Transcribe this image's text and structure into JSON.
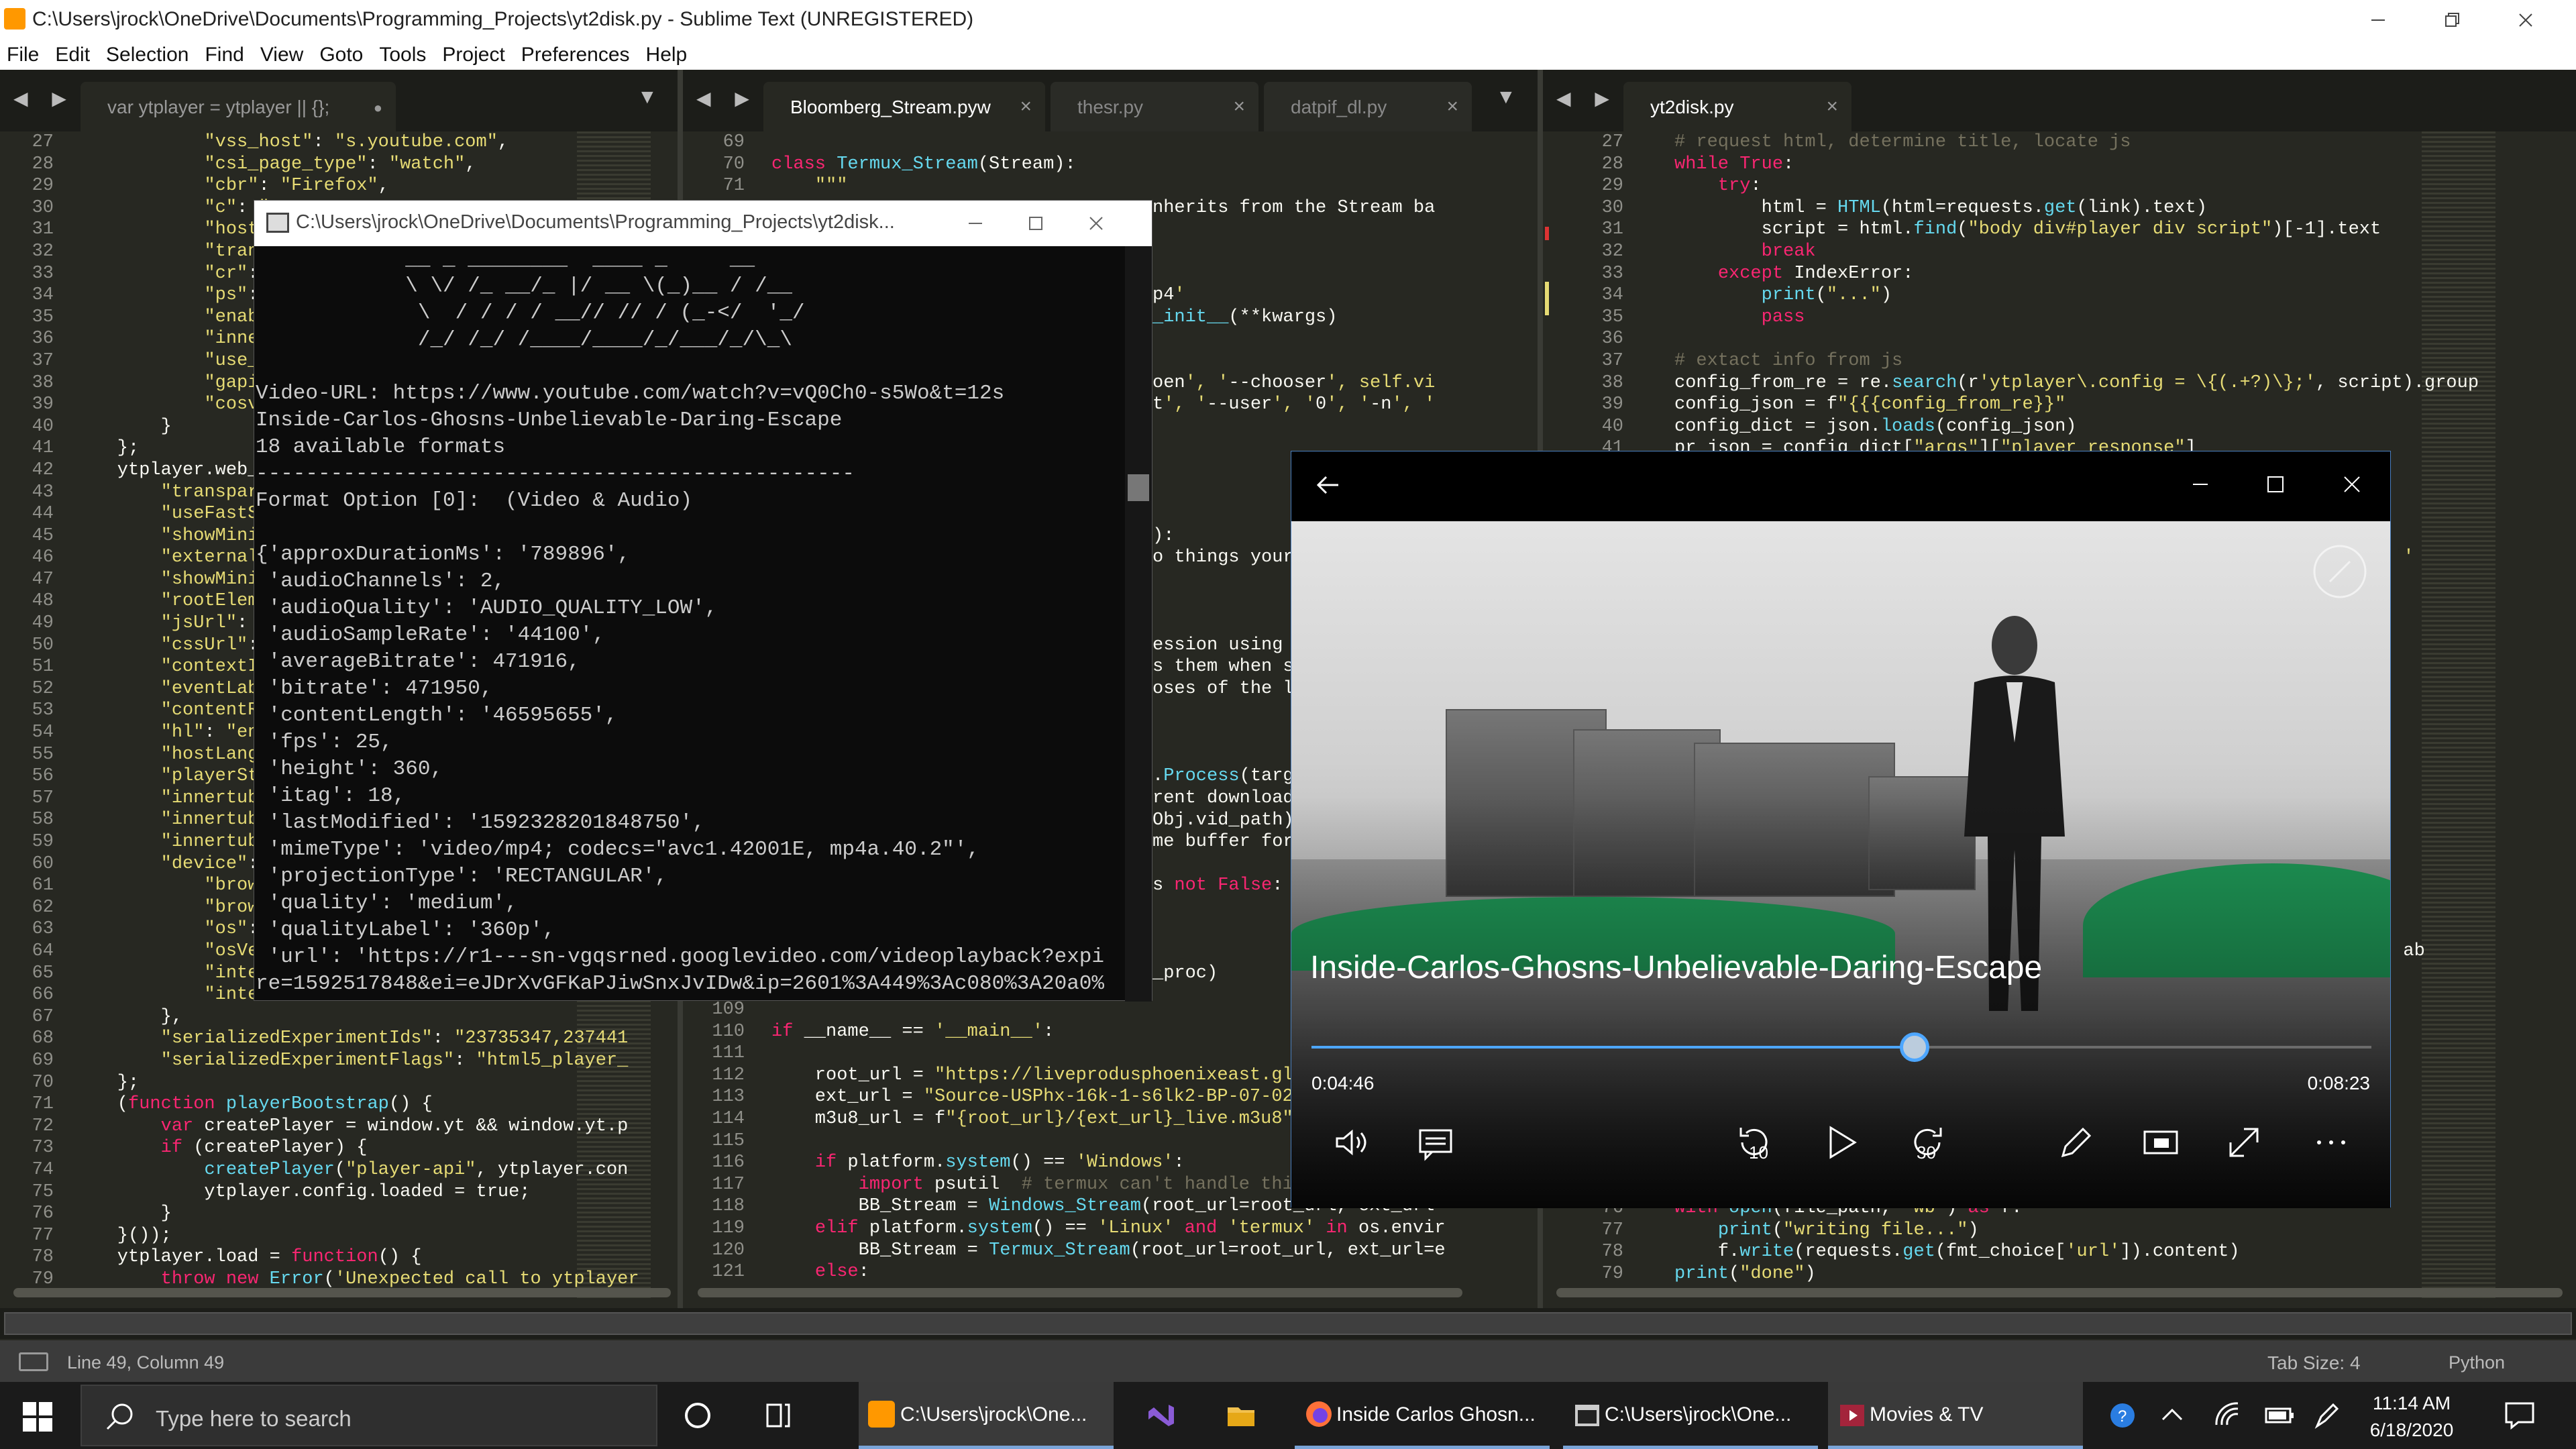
{
  "window": {
    "title": "C:\\Users\\jrock\\OneDrive\\Documents\\Programming_Projects\\yt2disk.py - Sublime Text (UNREGISTERED)"
  },
  "menu": [
    "File",
    "Edit",
    "Selection",
    "Find",
    "View",
    "Goto",
    "Tools",
    "Project",
    "Preferences",
    "Help"
  ],
  "pane1": {
    "tab": "var ytplayer = ytplayer || {};",
    "lines": [
      "27",
      "28",
      "29",
      "30",
      "31",
      "32",
      "33",
      "34",
      "35",
      "36",
      "37",
      "38",
      "39",
      "40",
      "41",
      "42",
      "43",
      "44",
      "45",
      "46",
      "47",
      "48",
      "49",
      "50",
      "51",
      "52",
      "53",
      "54",
      "55",
      "56",
      "57",
      "58",
      "59",
      "60",
      "61",
      "62",
      "63",
      "64",
      "65",
      "66",
      "67",
      "68",
      "69",
      "70",
      "71",
      "72",
      "73",
      "74",
      "75",
      "76",
      "77",
      "78",
      "79"
    ],
    "code": [
      "            \"vss_host\": \"s.youtube.com\",",
      "            \"csi_page_type\": \"watch\",",
      "            \"cbr\": \"Firefox\",",
      "            \"c\": \"WE",
      "            \"host_la",
      "            \"transpa",
      "            \"cr\": \"U",
      "            \"ps\": \"d",
      "            \"enablej",
      "            \"innertu",
      "            \"use_fas",
      "            \"gapi_hi",
      "            \"cosver\"",
      "        }",
      "    };",
      "    ytplayer.web_pla",
      "        \"transparent",
      "        \"useFastSiz",
      "        \"showMinipla",
      "        \"externalFul",
      "        \"showMinipla",
      "        \"rootElement",
      "        \"jsUrl\": \"/s",
      "        \"cssUrl\": \"/",
      "        \"contextId\":",
      "        \"eventLabel\"",
      "        \"contentRegi",
      "        \"hl\": \"en_US",
      "        \"hostLanguag",
      "        \"playerStyle",
      "        \"innertubeAp",
      "        \"innertubeAp",
      "        \"innertubeCo",
      "        \"device\": {",
      "            \"browser",
      "            \"browser",
      "            \"os\": \"W",
      "            \"osVersi",
      "            \"interfa",
      "            \"interfa",
      "        },",
      "        \"serializedExperimentIds\": \"23735347,237441",
      "        \"serializedExperimentFlags\": \"html5_player_",
      "    };",
      "    (function playerBootstrap() {",
      "        var createPlayer = window.yt && window.yt.p",
      "        if (createPlayer) {",
      "            createPlayer(\"player-api\", ytplayer.con",
      "            ytplayer.config.loaded = true;",
      "        }",
      "    }());",
      "    ytplayer.load = function() {",
      "        throw new Error('Unexpected call to ytplayer"
    ]
  },
  "pane2": {
    "tabs": [
      "Bloomberg_Stream.pyw",
      "thesr.py",
      "datpif_dl.py"
    ],
    "lines_top": [
      "69",
      "70",
      "71"
    ],
    "code_top": [
      "",
      "class Termux_Stream(Stream):",
      "    \"\"\""
    ],
    "right_fragments": [
      {
        "line": 3,
        "text": "nherits from the Stream ba"
      },
      {
        "line": 7,
        "text": "p4'"
      },
      {
        "line": 8,
        "text": "_init__(**kwargs)"
      },
      {
        "line": 11,
        "text": "oen', '--chooser', self.vi"
      },
      {
        "line": 12,
        "text": "t', '--user', '0', '-n', '"
      },
      {
        "line": 18,
        "text": "):"
      },
      {
        "line": 19,
        "text": "o things yours"
      },
      {
        "line": 23,
        "text": "ession using a"
      },
      {
        "line": 24,
        "text": "s them when st"
      },
      {
        "line": 25,
        "text": "oses of the le"
      },
      {
        "line": 29,
        "text": ".Process(targe"
      },
      {
        "line": 30,
        "text": "rent download"
      },
      {
        "line": 31,
        "text": "Obj.vid_path)"
      },
      {
        "line": 32,
        "text": "me buffer for"
      },
      {
        "line": 34,
        "text": "s not False:"
      },
      {
        "line": 38,
        "text": "_proc)"
      }
    ],
    "lines_bottom": [
      "109",
      "110",
      "111",
      "112",
      "113",
      "114",
      "115",
      "116",
      "117",
      "118",
      "119",
      "120",
      "121"
    ],
    "code_bottom": [
      "",
      "if __name__ == '__main__':",
      "",
      "    root_url = \"https://liveprodusphoenixeast.glob",
      "    ext_url = \"Source-USPhx-16k-1-s6lk2-BP-07-02-8",
      "    m3u8_url = f\"{root_url}/{ext_url}_live.m3u8\"",
      "",
      "    if platform.system() == 'Windows':",
      "        import psutil  # termux can't handle this,",
      "        BB_Stream = Windows_Stream(root_url=root_url, ext_url=",
      "    elif platform.system() == 'Linux' and 'termux' in os.envir",
      "        BB_Stream = Termux_Stream(root_url=root_url, ext_url=e",
      "    else:"
    ]
  },
  "pane3": {
    "tab": "yt2disk.py",
    "lines_top": [
      "27",
      "28",
      "29",
      "30",
      "31",
      "32",
      "33",
      "34",
      "35",
      "36",
      "37",
      "38",
      "39",
      "40",
      "41"
    ],
    "code_top": [
      "# request html, determine title, locate js",
      "while True:",
      "    try:",
      "        html = HTML(html=requests.get(link).text)",
      "        script = html.find(\"body div#player div script\")[-1].text",
      "        break",
      "    except IndexError:",
      "        print(\"...\")",
      "        pass",
      "",
      "# extact info from js",
      "config_from_re = re.search(r'ytplayer\\.config = \\{(.+?)\\};', script).group",
      "config_json = f\"{{{config_from_re}}\"",
      "config_dict = json.loads(config_json)",
      "pr_json = config_dict[\"args\"][\"player_response\"]"
    ],
    "lines_bottom": [
      "76",
      "77",
      "78",
      "79"
    ],
    "code_bottom": [
      "with open(file_path, \"wb\") as f:",
      "    print(\"writing file...\")",
      "    f.write(requests.get(fmt_choice['url']).content)",
      "print(\"done\")"
    ],
    "right_fragments": [
      {
        "line": 19,
        "text": ", '"
      },
      {
        "line": 37,
        "text": "n ab"
      }
    ]
  },
  "console": {
    "title": "C:\\Users\\jrock\\OneDrive\\Documents\\Programming_Projects\\yt2disk...",
    "lines": [
      "            __ _ ________  ____ _     __",
      "            \\ \\/ /_ __/_ |/ __ \\(_)__ / /__",
      "             \\  / / / / __// // / (_-</  '_/",
      "             /_/ /_/ /____/____/_/___/_/\\_\\",
      "",
      "Video-URL: https://www.youtube.com/watch?v=vQ0Ch0-s5Wo&t=12s",
      "Inside-Carlos-Ghosns-Unbelievable-Daring-Escape",
      "18 available formats",
      "------------------------------------------------",
      "Format Option [0]:  (Video & Audio)",
      "",
      "{'approxDurationMs': '789896',",
      " 'audioChannels': 2,",
      " 'audioQuality': 'AUDIO_QUALITY_LOW',",
      " 'audioSampleRate': '44100',",
      " 'averageBitrate': 471916,",
      " 'bitrate': 471950,",
      " 'contentLength': '46595655',",
      " 'fps': 25,",
      " 'height': 360,",
      " 'itag': 18,",
      " 'lastModified': '1592328201848750',",
      " 'mimeType': 'video/mp4; codecs=\"avc1.42001E, mp4a.40.2\"',",
      " 'projectionType': 'RECTANGULAR',",
      " 'quality': 'medium',",
      " 'qualityLabel': '360p',",
      " 'url': 'https://r1---sn-vgqsrned.googlevideo.com/videoplayback?expi",
      "re=1592517848&ei=eJDrXvGFKaPJiwSnxJvIDw&ip=2601%3A449%3Ac080%3A20a0%"
    ]
  },
  "player": {
    "video_title": "Inside-Carlos-Ghosns-Unbelievable-Daring-Escape",
    "current_time": "0:04:46",
    "duration": "0:08:23",
    "progress_fraction": 0.569,
    "skip_back": "10",
    "skip_fwd": "30"
  },
  "status": {
    "position": "Line 49, Column 49",
    "tab_size": "Tab Size: 4",
    "syntax": "Python"
  },
  "taskbar": {
    "search_placeholder": "Type here to search",
    "apps": [
      {
        "label": "C:\\Users\\jrock\\One..."
      },
      {
        "label": "Inside Carlos Ghosn..."
      },
      {
        "label": "C:\\Users\\jrock\\One..."
      },
      {
        "label": "Movies & TV"
      }
    ],
    "time": "11:14 AM",
    "date": "6/18/2020"
  },
  "colors": {
    "editor_bg": "#272822",
    "accent": "#4da6ff",
    "keyword": "#f92672",
    "string": "#e6db74",
    "comment": "#75715e",
    "function": "#66d9ef"
  }
}
